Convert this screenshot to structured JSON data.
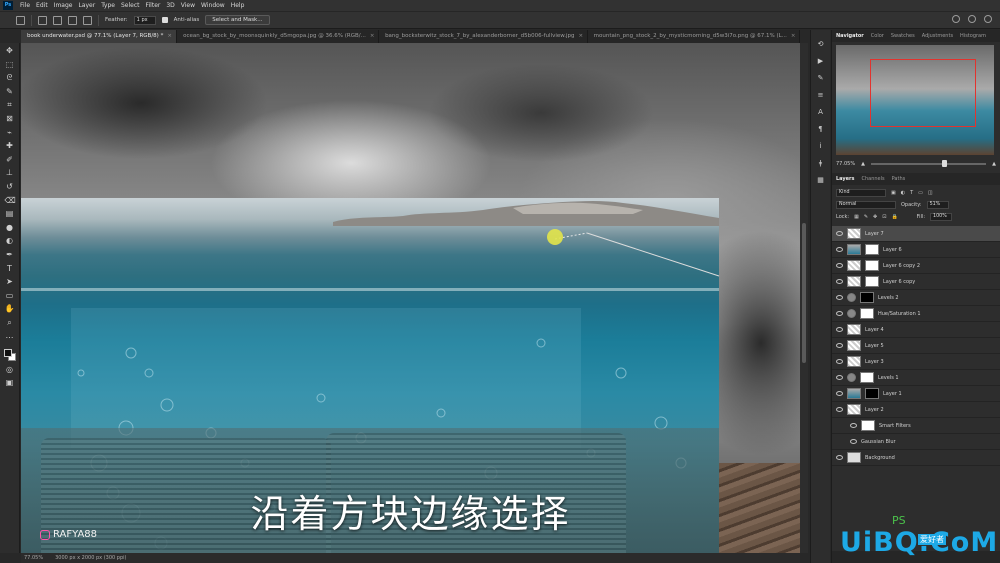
{
  "app": {
    "logo_text": "Ps",
    "menu": [
      "File",
      "Edit",
      "Image",
      "Layer",
      "Type",
      "Select",
      "Filter",
      "3D",
      "View",
      "Window",
      "Help"
    ]
  },
  "options": {
    "feather_label": "Feather:",
    "feather_value": "1 px",
    "antialias_label": "Anti-alias",
    "select_mask_label": "Select and Mask..."
  },
  "tabs": [
    {
      "label": "book underwater.psd @ 77.1% (Layer 7, RGB/8) *",
      "active": true
    },
    {
      "label": "ocean_bg_stock_by_moonsquinkly_d5mgopa.jpg @ 36.6% (RGB/...",
      "active": false
    },
    {
      "label": "bang_bocksterwitz_stock_7_by_alexanderborner_d5b006-fullview.jpg",
      "active": false
    },
    {
      "label": "mountain_png_stock_2_by_mysticmorning_d5w3i7o.png @ 67.1% (L...",
      "active": false
    }
  ],
  "canvas": {
    "subtitle": "沿着方块边缘选择",
    "watermark_handle": "RAFYA88"
  },
  "status": {
    "zoom": "77.05%",
    "doc_size": "3000 px x 2000 px (300 ppi)"
  },
  "navigator": {
    "tabs": [
      "Navigator",
      "Color",
      "Swatches",
      "Adjustments",
      "Histogram"
    ],
    "zoom": "77.05%",
    "zoom_fraction": 0.62
  },
  "layers_panel": {
    "tabs": [
      "Layers",
      "Channels",
      "Paths"
    ],
    "kind_filter": "Kind",
    "blend_mode": "Normal",
    "opacity_label": "Opacity:",
    "opacity_value": "51%",
    "lock_label": "Lock:",
    "fill_label": "Fill:",
    "fill_value": "100%",
    "layers": [
      {
        "name": "Layer 7",
        "thumb": "chk",
        "mask": false,
        "selected": true,
        "indent": false
      },
      {
        "name": "Layer 6",
        "thumb": "water",
        "mask": "white",
        "selected": false,
        "indent": false
      },
      {
        "name": "Layer 6 copy 2",
        "thumb": "chk",
        "mask": "white",
        "selected": false,
        "indent": false
      },
      {
        "name": "Layer 6 copy",
        "thumb": "chk",
        "mask": "white",
        "selected": false,
        "indent": false
      },
      {
        "name": "Levels 2",
        "thumb": "adj",
        "mask": "black",
        "selected": false,
        "indent": false
      },
      {
        "name": "Hue/Saturation 1",
        "thumb": "adj",
        "mask": "white",
        "selected": false,
        "indent": false
      },
      {
        "name": "Layer 4",
        "thumb": "chk",
        "mask": false,
        "selected": false,
        "indent": false
      },
      {
        "name": "Layer 5",
        "thumb": "chk",
        "mask": false,
        "selected": false,
        "indent": false
      },
      {
        "name": "Layer 3",
        "thumb": "chk",
        "mask": false,
        "selected": false,
        "indent": false
      },
      {
        "name": "Levels 1",
        "thumb": "adj",
        "mask": "white",
        "selected": false,
        "indent": false
      },
      {
        "name": "Layer 1",
        "thumb": "water",
        "mask": "black",
        "selected": false,
        "indent": false
      },
      {
        "name": "Layer 2",
        "thumb": "chk",
        "mask": false,
        "selected": false,
        "indent": false
      },
      {
        "name": "Smart Filters",
        "thumb": false,
        "mask": "white",
        "selected": false,
        "indent": true
      },
      {
        "name": "Gaussian Blur",
        "thumb": false,
        "mask": false,
        "selected": false,
        "indent": true
      },
      {
        "name": "Background",
        "thumb": "white",
        "mask": false,
        "selected": false,
        "indent": false
      }
    ]
  },
  "brand": {
    "text": "UiBQ.CoM",
    "ps": "PS",
    "sub": "爱好者"
  },
  "colors": {
    "accent": "#31a8ff",
    "nav_frame": "#e2332e",
    "cursor": "#e2e44a",
    "brand": "#1da9e6"
  }
}
